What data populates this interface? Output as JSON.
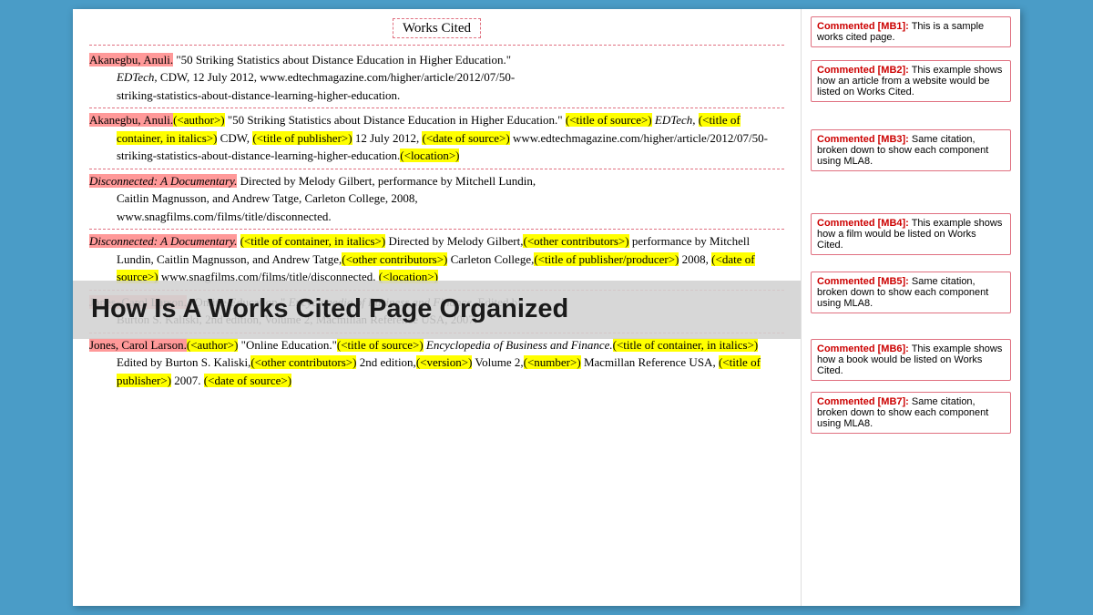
{
  "page": {
    "title": "How Is A Works Cited Page Organized",
    "background_color": "#4a9cc7"
  },
  "document": {
    "works_cited_title": "Works Cited",
    "sections": [
      {
        "id": "entry1",
        "lines": [
          "Akanegbu, Anuli. \"50 Striking Statistics about Distance Education in Higher Education.\"",
          "EDTech, CDW, 12 July 2012, www.edtechmagazine.com/higher/article/2012/07/50-",
          "striking-statistics-about-distance-learning-higher-education."
        ]
      },
      {
        "id": "entry1_breakdown",
        "lines": [
          "Akanegbu, Anuli, (<author>) \"50 Striking Statistics about Distance Education in Higher Education.\" (<title of source>) EDTech, (<title of container, in italics>) CDW, (<title of publisher>) 12 July 2012, (<date of source>) www.edtechmagazine.com/higher/article/2012/07/50-striking-statistics-about-distance-learning-higher-education.(<location>)"
        ]
      },
      {
        "id": "entry2",
        "lines": [
          "Disconnected: A Documentary. Directed by Melody Gilbert, performance by Mitchell Lundin,",
          "Caitlin Magnusson, and Andrew Tatge, Carleton College, 2008,",
          "www.snagfilms.com/films/title/disconnected."
        ]
      },
      {
        "id": "entry2_breakdown",
        "lines": [
          "Disconnected: A Documentary, (<title of container, in italics>) Directed by Melody Gilbert,(<other contributors>) performance by Mitchell Lundin, Caitlin Magnusson, and Andrew Tatge,(<other contributors>) Carleton College,(<title of publisher/producer>) 2008, (<date of source>) www.snagfilms.com/films/title/disconnected. (<location>)"
        ]
      },
      {
        "id": "entry3",
        "lines": [
          "Jones, Carol Larson. \"Online Education.\" Encyclopedia of Business and Finance. Edited by",
          "Burton S. Kaliski, 2nd edition, Volume 2, Macmillan Reference USA, 2007."
        ]
      },
      {
        "id": "entry3_breakdown",
        "lines": [
          "Jones, Carol Larson,(<author>) \"Online Education.\"(<title of source>) Encyclopedia of Business and Finance.(<title of container, in italics>) Edited by Burton S. Kaliski,(<other contributors>) 2nd edition,(<version>) Volume 2,(<number>) Macmillan Reference USA, (<title of publisher>) 2007. (<date of source>)"
        ]
      }
    ]
  },
  "comments": [
    {
      "id": "MB1",
      "label": "Commented [MB1]:",
      "text": "This is a sample works cited page."
    },
    {
      "id": "MB2",
      "label": "Commented [MB2]:",
      "text": "This example shows how an article from a website would be listed on Works Cited."
    },
    {
      "id": "MB3",
      "label": "Commented [MB3]:",
      "text": "Same citation, broken down to show each component using MLA8."
    },
    {
      "id": "MB4",
      "label": "Commented [MB4]:",
      "text": "This example shows how a film would be listed on Works Cited."
    },
    {
      "id": "MB5",
      "label": "Commented [MB5]:",
      "text": "Same citation, broken down to show each component using MLA8."
    },
    {
      "id": "MB6",
      "label": "Commented [MB6]:",
      "text": "This example shows how a book would be listed on Works Cited."
    },
    {
      "id": "MB7",
      "label": "Commented [MB7]:",
      "text": "Same citation, broken down to show each component using MLA8."
    }
  ],
  "overlay": {
    "text": "How Is A Works Cited Page Organized"
  }
}
